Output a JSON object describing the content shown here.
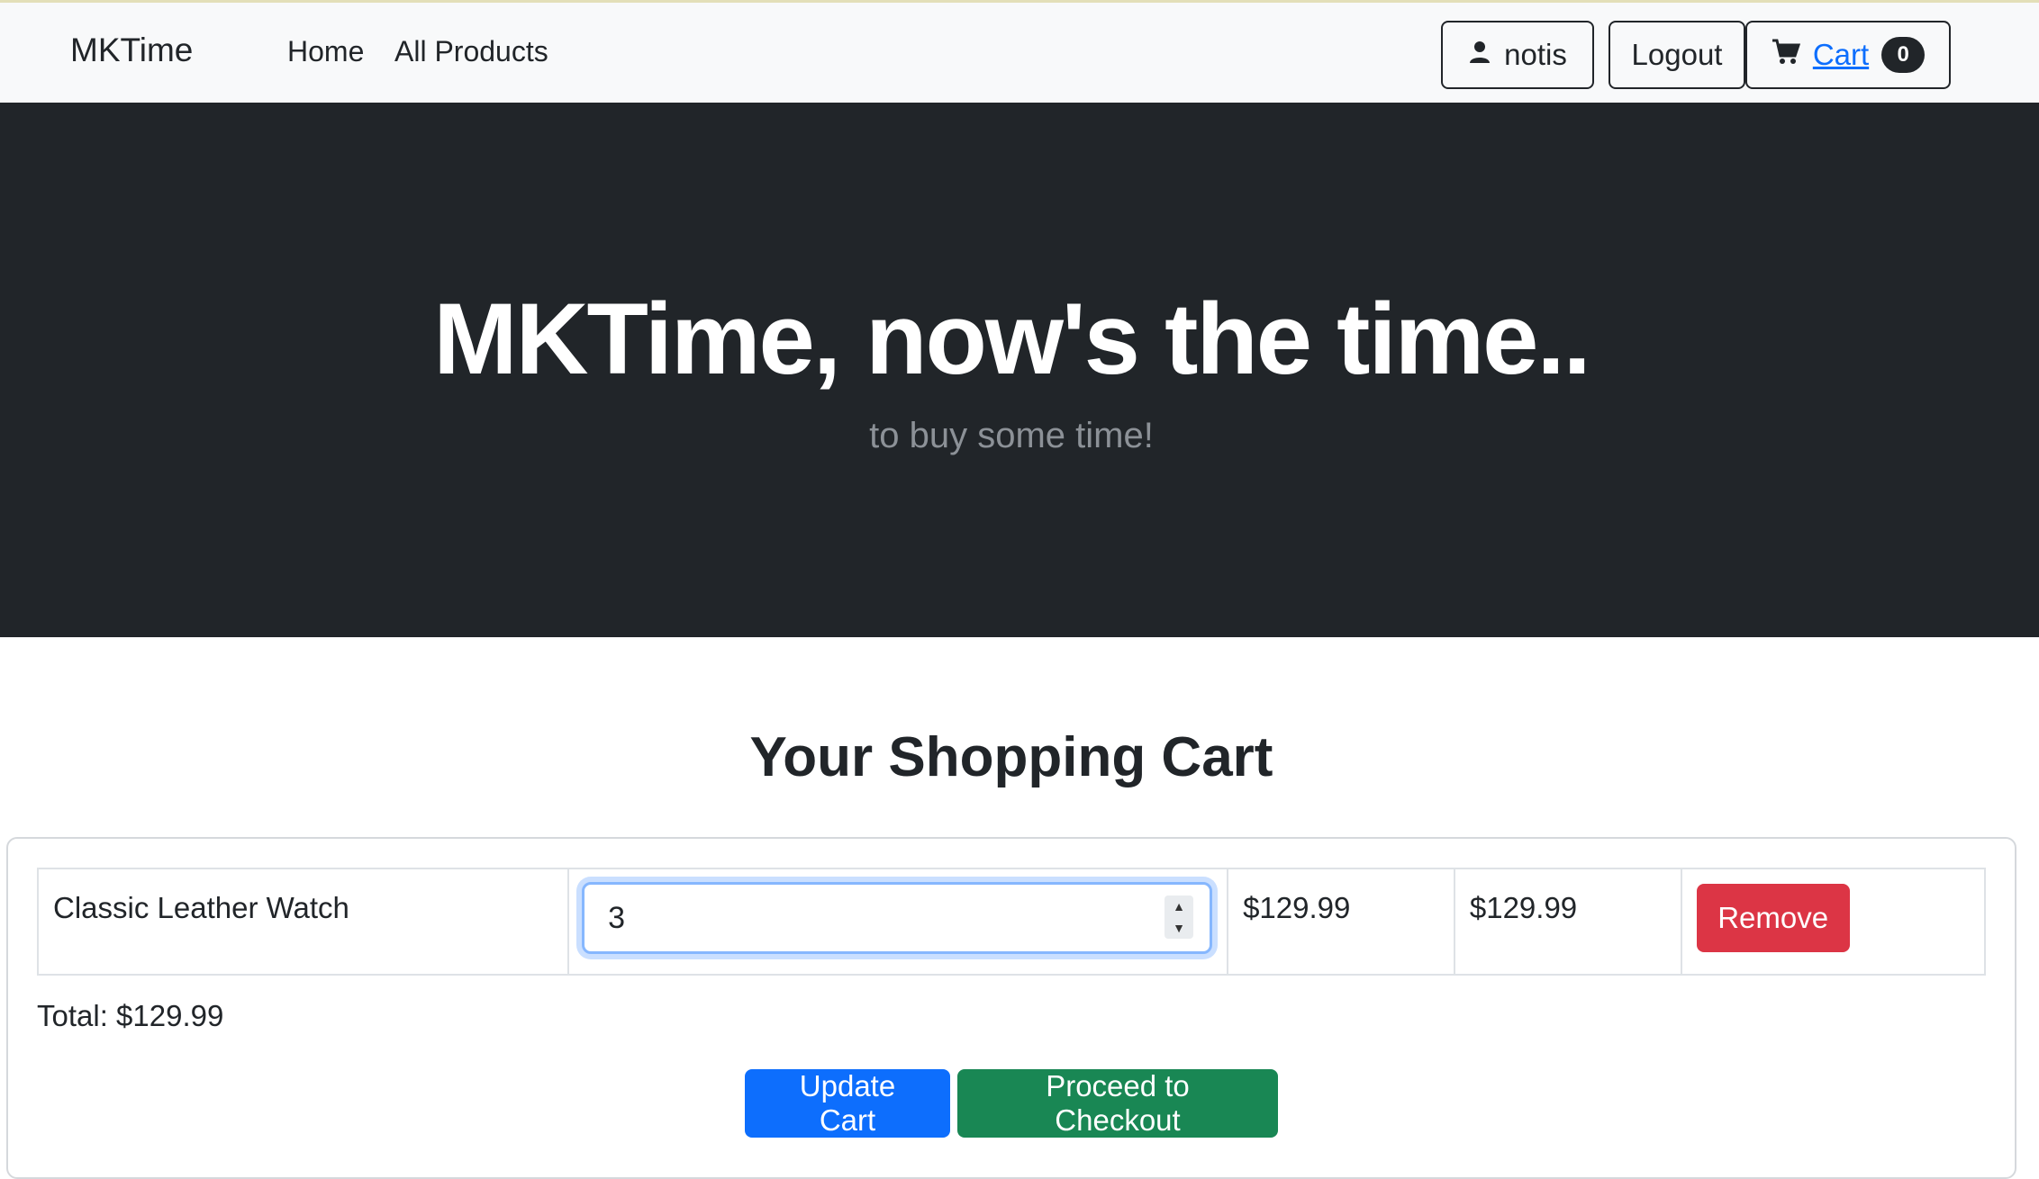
{
  "navbar": {
    "brand": "MKTime",
    "links": [
      {
        "label": "Home"
      },
      {
        "label": "All Products"
      }
    ],
    "user_label": "notis",
    "logout_label": "Logout",
    "cart_label": "Cart",
    "cart_count": "0"
  },
  "hero": {
    "title": "MKTime, now's the time..",
    "subtitle": "to buy some time!"
  },
  "cart": {
    "heading": "Your Shopping Cart",
    "items": [
      {
        "name": "Classic Leather Watch",
        "quantity": "3",
        "price": "$129.99",
        "subtotal": "$129.99",
        "remove_label": "Remove"
      }
    ],
    "total_label": "Total: $129.99",
    "update_label": "Update Cart",
    "checkout_label": "Proceed to Checkout"
  },
  "colors": {
    "primary": "#0d6efd",
    "success": "#198754",
    "danger": "#dc3545",
    "dark": "#212529"
  },
  "icons": [
    "user-icon",
    "cart-icon",
    "spinner-up-icon",
    "spinner-down-icon"
  ]
}
